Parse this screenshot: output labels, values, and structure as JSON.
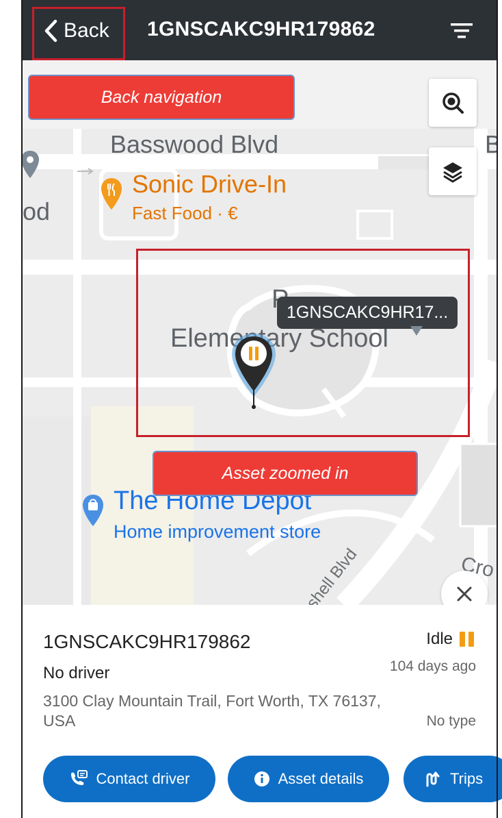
{
  "header": {
    "back_label": "Back",
    "title": "1GNSCAKC9HR179862"
  },
  "map": {
    "streets": {
      "basswood": "Basswood Blvd",
      "partial_left": "od",
      "partial_right": "B",
      "shell_blvd": "shell Blvd",
      "cro": "Cro"
    },
    "pois": {
      "sonic_name": "Sonic Drive-In",
      "sonic_sub": "Fast Food · €",
      "school": "Elementary School",
      "school_partial": "P",
      "home_depot_name": "The Home Depot",
      "home_depot_sub": "Home improvement store"
    },
    "asset_tooltip": "1GNSCAKC9HR17...",
    "annotations": {
      "back_callout": "Back navigation",
      "asset_callout": "Asset zoomed in"
    },
    "icons": {
      "zoom": "search-target-icon",
      "layers": "layers-icon",
      "close": "close-icon",
      "pin": "pause-pin-icon"
    }
  },
  "panel": {
    "asset_id": "1GNSCAKC9HR179862",
    "status": "Idle",
    "status_color": "#f39c12",
    "driver": "No driver",
    "last_seen": "104 days ago",
    "address": "3100 Clay Mountain Trail, Fort Worth, TX 76137, USA",
    "type": "No type",
    "actions": {
      "contact_driver": "Contact driver",
      "asset_details": "Asset details",
      "trips": "Trips"
    }
  },
  "colors": {
    "header_bg": "#2c3136",
    "primary": "#0f6fc6",
    "callout_red": "#ed3b36",
    "highlight_red": "#c7202b"
  }
}
